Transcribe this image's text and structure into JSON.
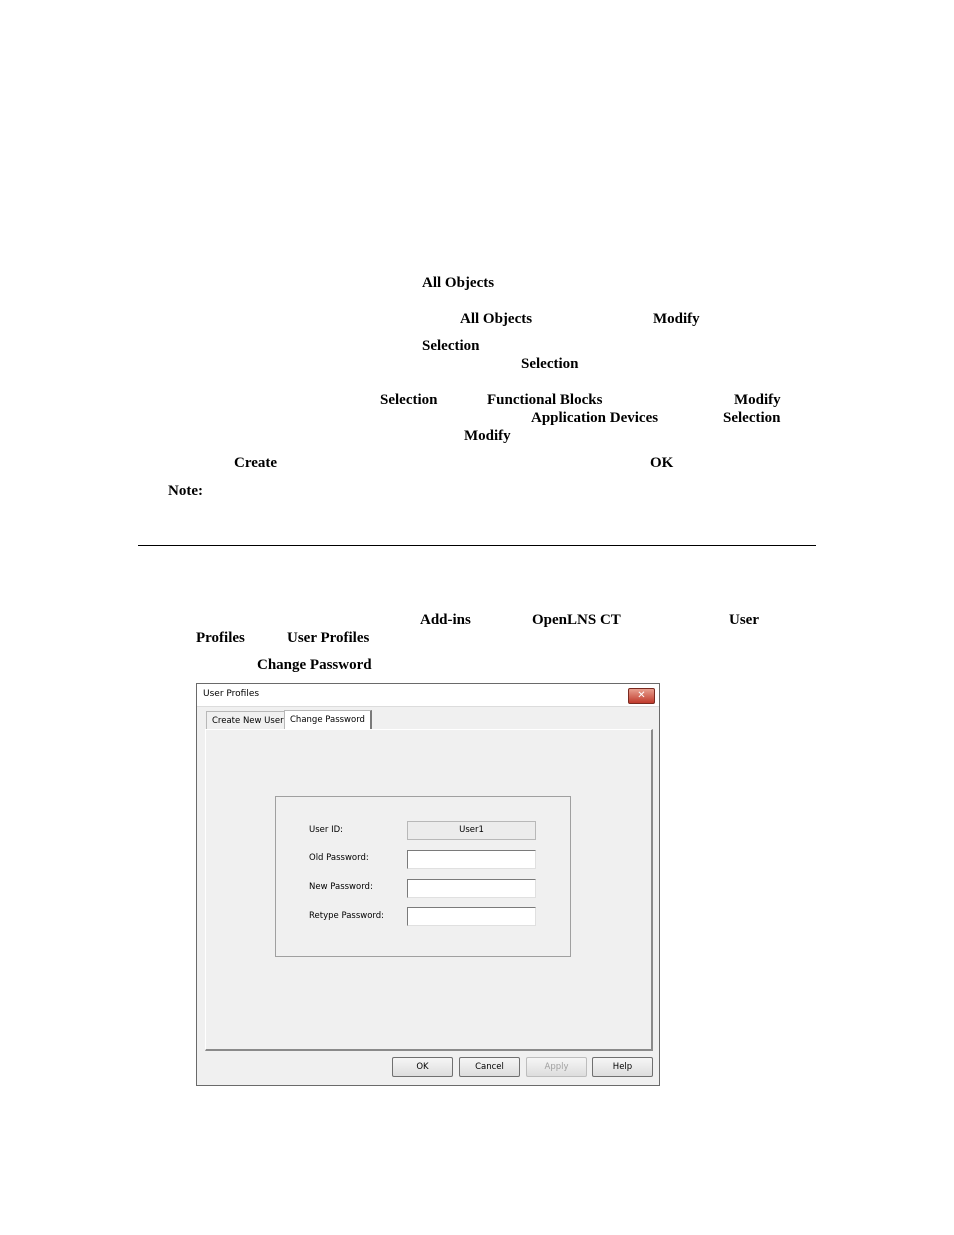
{
  "page": {
    "lines": {
      "l1": [
        "All Objects"
      ],
      "l2": [
        "All Objects",
        "Modify"
      ],
      "l3": [
        "Selection"
      ],
      "l4": [
        "Selection"
      ],
      "l5": [
        "Selection",
        "Functional Blocks",
        "Modify"
      ],
      "l6": [
        "Application Devices",
        "Selection"
      ],
      "l7": [
        "Modify"
      ],
      "l8": [
        "Create",
        "OK"
      ],
      "note": "Note:",
      "l9": [
        "Add-ins",
        "OpenLNS CT",
        "User"
      ],
      "l10": [
        "Profiles",
        "User Profiles"
      ],
      "l11": [
        "Change Password"
      ]
    }
  },
  "dialog": {
    "title": "User Profiles",
    "close_glyph": "✕",
    "tabs": [
      "Create New User",
      "Change Password"
    ],
    "active_tab": "Change Password",
    "fields": {
      "user_id_label": "User ID:",
      "user_id_value": "User1",
      "old_password_label": "Old Password:",
      "old_password_value": "",
      "new_password_label": "New Password:",
      "new_password_value": "",
      "retype_password_label": "Retype Password:",
      "retype_password_value": ""
    },
    "buttons": {
      "ok": "OK",
      "cancel": "Cancel",
      "apply": "Apply",
      "help": "Help"
    }
  }
}
